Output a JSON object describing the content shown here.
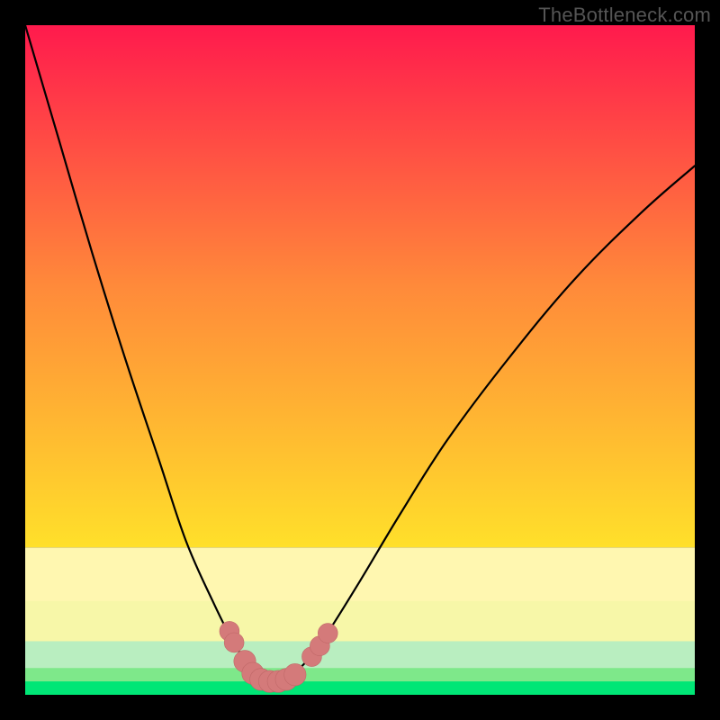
{
  "attribution": "TheBottleneck.com",
  "colors": {
    "gradient_top": "#ff1a4d",
    "gradient_orange": "#ff8a3a",
    "gradient_yellow": "#ffe02a",
    "band_pale_top": "#fff7b0",
    "band_pale_bottom": "#f7f7a8",
    "band_green_light": "#7ee88a",
    "band_green": "#00e676",
    "curve_stroke": "#000000",
    "marker_fill": "#d47a7a",
    "marker_stroke": "#c06868",
    "watermark": "#555555"
  },
  "chart_data": {
    "type": "line",
    "title": "",
    "xlabel": "",
    "ylabel": "",
    "xlim": [
      0,
      100
    ],
    "ylim": [
      0,
      100
    ],
    "series": [
      {
        "name": "bottleneck-curve",
        "x": [
          0,
          5,
          10,
          15,
          20,
          24,
          28,
          31,
          33,
          34.5,
          35.5,
          36.5,
          37.5,
          38.5,
          40,
          42,
          45,
          50,
          56,
          63,
          72,
          82,
          92,
          100
        ],
        "values": [
          100,
          83,
          66,
          50,
          35,
          23,
          14,
          8,
          5,
          3,
          2.2,
          2,
          2,
          2.3,
          3.2,
          5,
          9,
          17,
          27,
          38,
          50,
          62,
          72,
          79
        ]
      }
    ],
    "markers": {
      "name": "highlighted-points",
      "color": "#d47a7a",
      "points": [
        {
          "x": 30.5,
          "y": 9.5,
          "r": 1.1
        },
        {
          "x": 31.2,
          "y": 7.8,
          "r": 1.1
        },
        {
          "x": 32.8,
          "y": 5.0,
          "r": 1.3
        },
        {
          "x": 34.0,
          "y": 3.2,
          "r": 1.3
        },
        {
          "x": 35.2,
          "y": 2.3,
          "r": 1.3
        },
        {
          "x": 36.5,
          "y": 2.0,
          "r": 1.3
        },
        {
          "x": 37.8,
          "y": 2.0,
          "r": 1.3
        },
        {
          "x": 39.0,
          "y": 2.3,
          "r": 1.3
        },
        {
          "x": 40.3,
          "y": 3.0,
          "r": 1.3
        },
        {
          "x": 42.8,
          "y": 5.7,
          "r": 1.1
        },
        {
          "x": 44.0,
          "y": 7.3,
          "r": 1.1
        },
        {
          "x": 45.2,
          "y": 9.2,
          "r": 1.1
        }
      ]
    },
    "gradient_bands": [
      {
        "from_y": 100,
        "to_y": 22,
        "type": "smooth",
        "colors": [
          "#ff1a4d",
          "#ff8a3a",
          "#ffe02a"
        ]
      },
      {
        "from_y": 22,
        "to_y": 14,
        "type": "solid",
        "color": "#fff7b0"
      },
      {
        "from_y": 14,
        "to_y": 8,
        "type": "solid",
        "color": "#f7f7a8"
      },
      {
        "from_y": 8,
        "to_y": 4,
        "type": "solid",
        "color": "#b9eec0"
      },
      {
        "from_y": 4,
        "to_y": 2,
        "type": "solid",
        "color": "#7ee88a"
      },
      {
        "from_y": 2,
        "to_y": 0,
        "type": "solid",
        "color": "#00e676"
      }
    ]
  }
}
